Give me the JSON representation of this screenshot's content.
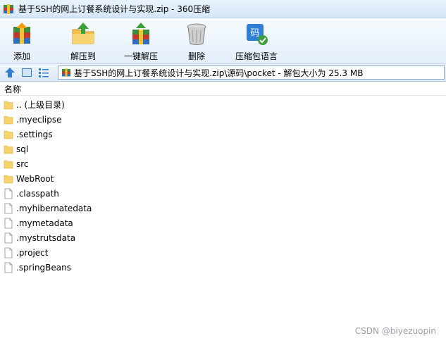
{
  "window": {
    "title": "基于SSH的网上订餐系统设计与实现.zip - 360压缩"
  },
  "toolbar": {
    "add": "添加",
    "extract_to": "解压到",
    "one_key_extract": "一键解压",
    "delete": "删除",
    "language": "压缩包语言",
    "lang_badge": "码"
  },
  "address": {
    "path": "基于SSH的网上订餐系统设计与实现.zip\\源码\\pocket - 解包大小为 25.3 MB"
  },
  "list": {
    "column_name": "名称",
    "items": [
      {
        "name": ".. (上级目录)",
        "type": "folder"
      },
      {
        "name": ".myeclipse",
        "type": "folder"
      },
      {
        "name": ".settings",
        "type": "folder"
      },
      {
        "name": "sql",
        "type": "folder"
      },
      {
        "name": "src",
        "type": "folder"
      },
      {
        "name": "WebRoot",
        "type": "folder"
      },
      {
        "name": ".classpath",
        "type": "file"
      },
      {
        "name": ".myhibernatedata",
        "type": "file"
      },
      {
        "name": ".mymetadata",
        "type": "file"
      },
      {
        "name": ".mystrutsdata",
        "type": "file"
      },
      {
        "name": ".project",
        "type": "file"
      },
      {
        "name": ".springBeans",
        "type": "file"
      }
    ]
  },
  "watermark": "CSDN @biyezuopin",
  "colors": {
    "folder": "#f6d46b",
    "toolbar_bg": "#e3eefa",
    "accent_blue": "#2f7fd4"
  }
}
